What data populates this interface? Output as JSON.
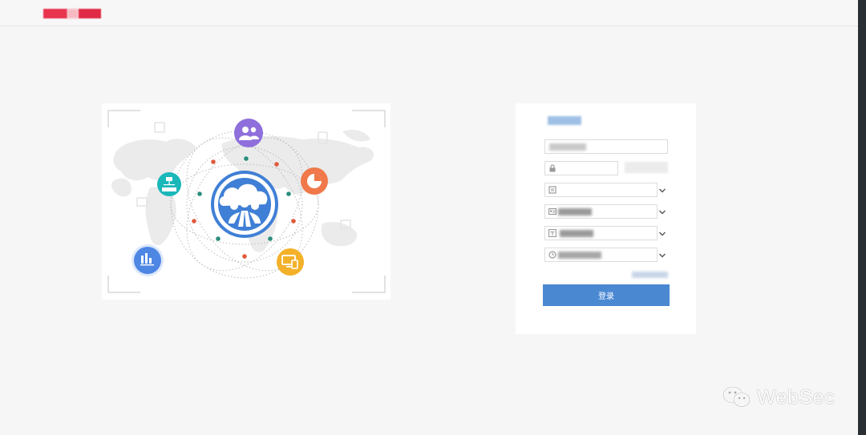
{
  "header": {
    "logo_text": "",
    "logo_colors": [
      "#e8344d",
      "#f06a7c",
      "#e02a45"
    ]
  },
  "login": {
    "title": "",
    "username_placeholder": "",
    "password_placeholder": "",
    "captcha_image_text": "",
    "select_1_value": "",
    "select_2_value": "",
    "select_3_value": "",
    "select_4_value": "",
    "forgot_link": "",
    "submit_label": "登录"
  },
  "illustration": {
    "center_icon": "cloud-users-icon",
    "satellite_icons": [
      "users-icon",
      "pie-chart-icon",
      "devices-icon",
      "bar-chart-icon",
      "org-chart-icon"
    ]
  },
  "watermark": {
    "text": "WebSec",
    "icon": "wechat-icon"
  },
  "colors": {
    "accent": "#4a88d2",
    "background": "#f7f6f7"
  }
}
